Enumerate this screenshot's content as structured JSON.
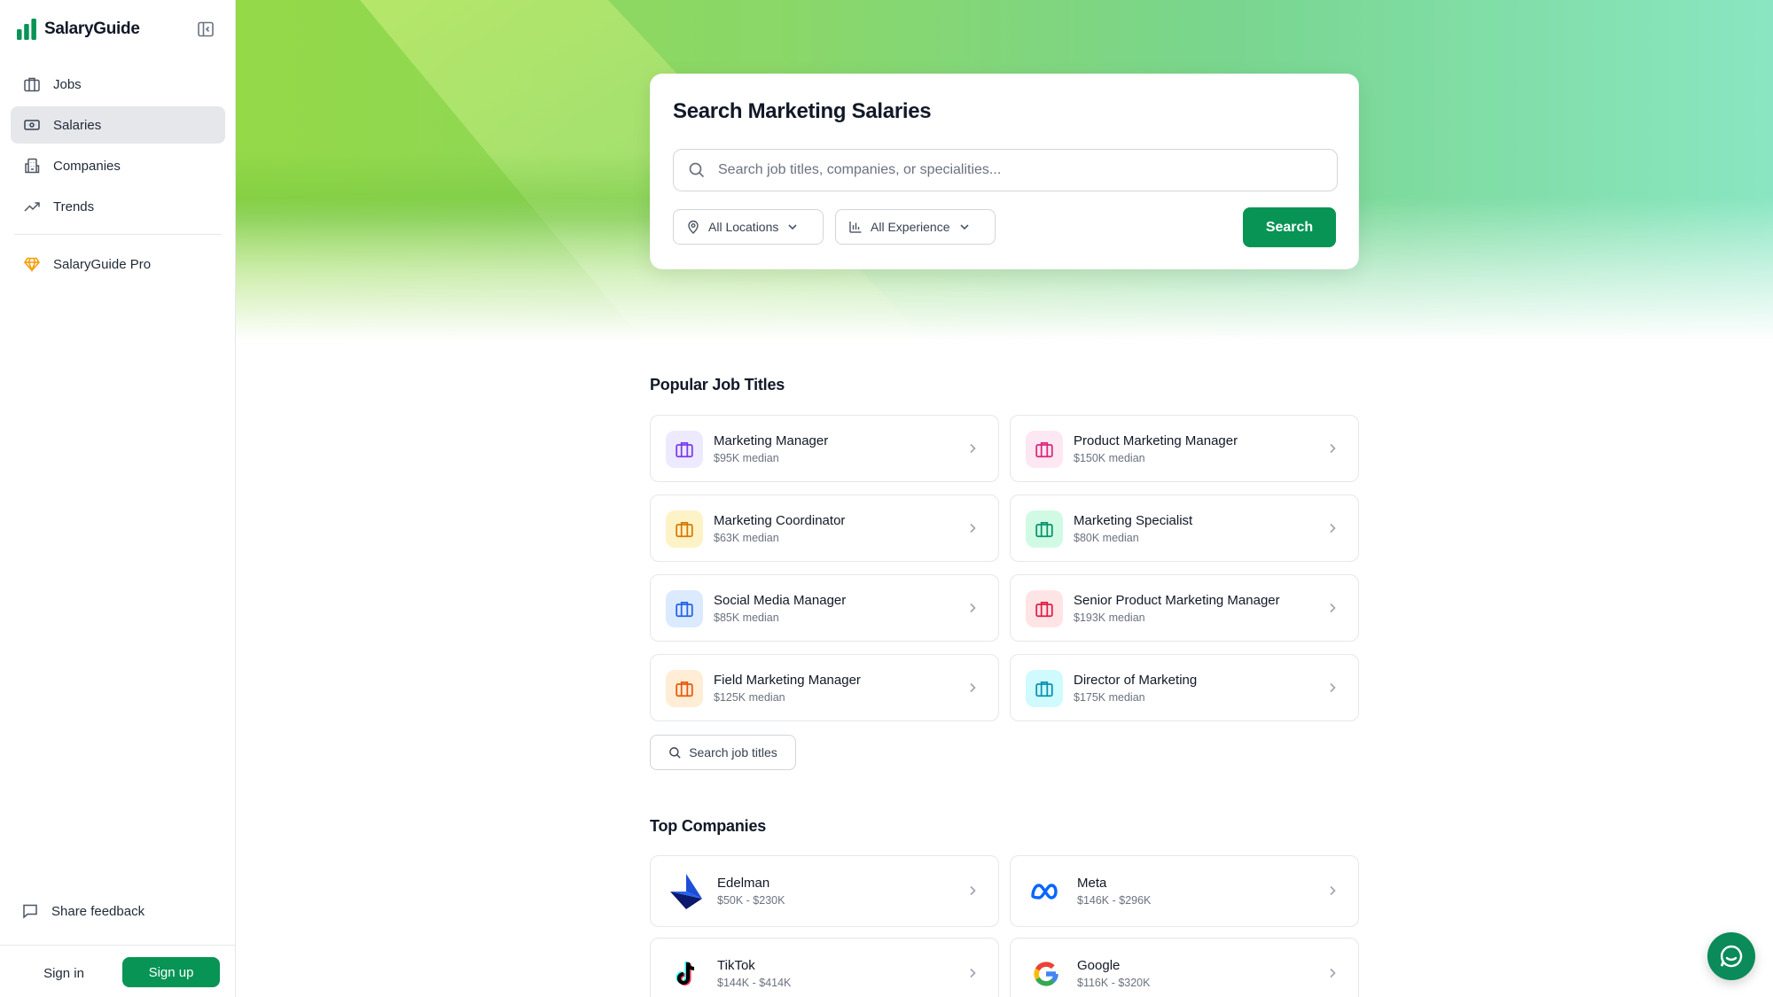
{
  "app": {
    "name": "SalaryGuide"
  },
  "sidebar": {
    "items": [
      {
        "label": "Jobs",
        "icon": "briefcase-icon"
      },
      {
        "label": "Salaries",
        "icon": "banknote-icon",
        "active": true
      },
      {
        "label": "Companies",
        "icon": "building-icon"
      },
      {
        "label": "Trends",
        "icon": "trending-up-icon"
      }
    ],
    "pro": {
      "label": "SalaryGuide Pro",
      "icon": "gem-icon"
    },
    "feedback": "Share feedback",
    "sign_in": "Sign in",
    "sign_up": "Sign up"
  },
  "search": {
    "title": "Search Marketing Salaries",
    "placeholder": "Search job titles, companies, or specialities...",
    "location_filter": "All Locations",
    "experience_filter": "All Experience",
    "button": "Search"
  },
  "popular_jobs": {
    "title": "Popular Job Titles",
    "items": [
      {
        "title": "Marketing Manager",
        "median": "$95K median",
        "color": "#7c3aed",
        "bg": "#ede9fe"
      },
      {
        "title": "Product Marketing Manager",
        "median": "$150K median",
        "color": "#db2777",
        "bg": "#fce7f3"
      },
      {
        "title": "Marketing Coordinator",
        "median": "$63K median",
        "color": "#d97706",
        "bg": "#fef3c7"
      },
      {
        "title": "Marketing Specialist",
        "median": "$80K median",
        "color": "#059669",
        "bg": "#d1fae5"
      },
      {
        "title": "Social Media Manager",
        "median": "$85K median",
        "color": "#2563eb",
        "bg": "#dbeafe"
      },
      {
        "title": "Senior Product Marketing Manager",
        "median": "$193K median",
        "color": "#e11d48",
        "bg": "#ffe4e6"
      },
      {
        "title": "Field Marketing Manager",
        "median": "$125K median",
        "color": "#ea580c",
        "bg": "#ffedd5"
      },
      {
        "title": "Director of Marketing",
        "median": "$175K median",
        "color": "#0891b2",
        "bg": "#cffafe"
      }
    ],
    "search_button": "Search job titles"
  },
  "top_companies": {
    "title": "Top Companies",
    "items": [
      {
        "name": "Edelman",
        "range": "$50K - $230K",
        "logo": "edelman-logo"
      },
      {
        "name": "Meta",
        "range": "$146K - $296K",
        "logo": "meta-logo"
      },
      {
        "name": "TikTok",
        "range": "$144K - $414K",
        "logo": "tiktok-logo"
      },
      {
        "name": "Google",
        "range": "$116K - $320K",
        "logo": "google-logo"
      }
    ]
  },
  "colors": {
    "accent": "#079455",
    "chat": "#0b8a5a"
  }
}
